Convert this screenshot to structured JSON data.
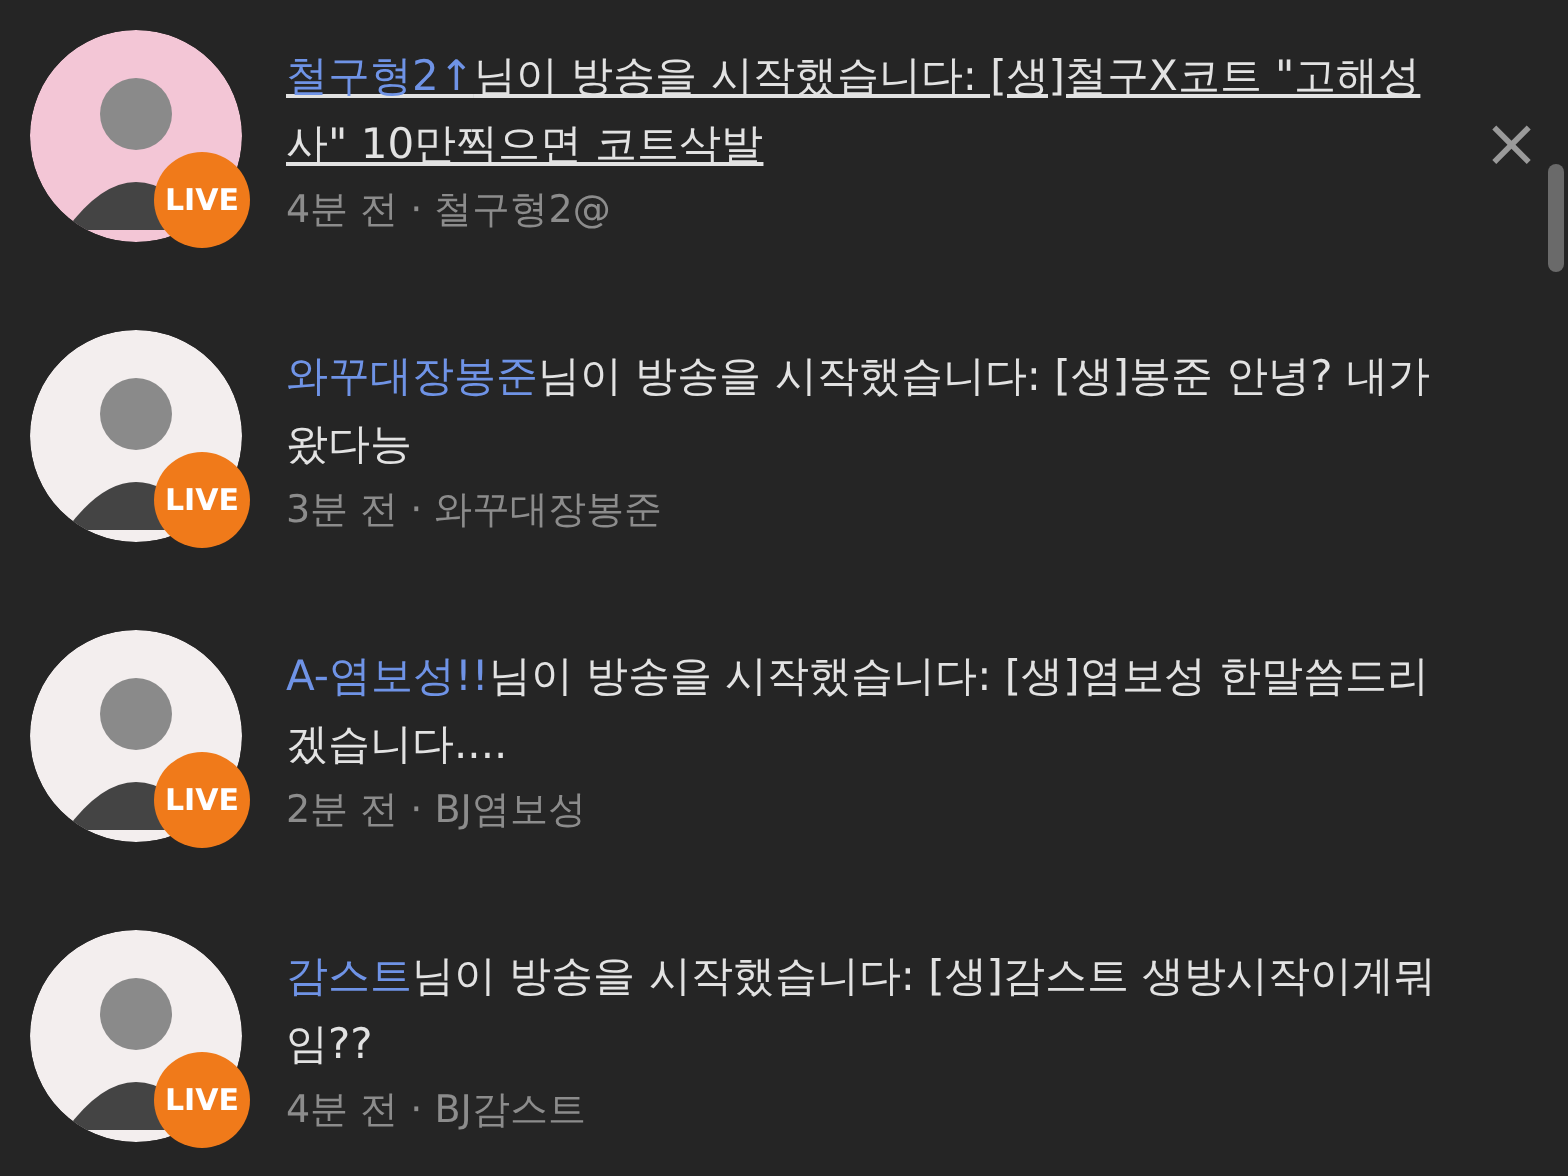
{
  "notifications": [
    {
      "user": "철구형2↑",
      "message": "님이 방송을 시작했습니다: [생]철구X코트 \"고해성사\" 10만찍으면 코트삭발",
      "meta": "4분 전 · 철구형2@",
      "badge": "LIVE",
      "hovered": true,
      "close": "×"
    },
    {
      "user": "와꾸대장봉준",
      "message": "님이 방송을 시작했습니다: [생]봉준 안녕? 내가왔다능",
      "meta": "3분 전 · 와꾸대장봉준",
      "badge": "LIVE",
      "hovered": false
    },
    {
      "user": "A-염보성!!",
      "message": "님이 방송을 시작했습니다: [생]염보성 한말씀드리겠습니다....",
      "meta": "2분 전 · BJ염보성",
      "badge": "LIVE",
      "hovered": false
    },
    {
      "user": "감스트",
      "message": "님이 방송을 시작했습니다: [생]감스트 생방시작이게뭐임??",
      "meta": "4분 전 · BJ감스트",
      "badge": "LIVE",
      "hovered": false
    }
  ]
}
